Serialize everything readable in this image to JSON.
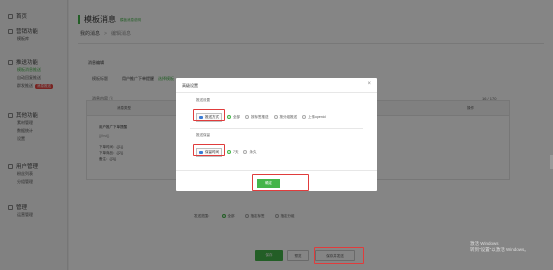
{
  "sidebar": {
    "groups": [
      {
        "label": "首页",
        "items": []
      },
      {
        "label": "营销功能",
        "items": [
          "模板库"
        ]
      },
      {
        "label": "推送功能",
        "items": [
          "模板消息推送",
          "自动回复推送",
          "群发推送"
        ],
        "badge": "消息推送"
      },
      {
        "label": "其他功能",
        "items": [
          "素材管理",
          "数据统计",
          "设置"
        ]
      },
      {
        "label": "用户管理",
        "items": [
          "粉丝列表",
          "分组管理"
        ]
      },
      {
        "label": "管理",
        "items": [
          "运营管理"
        ]
      }
    ]
  },
  "header": {
    "title": "模板消息",
    "subtitle": "模板消息说明"
  },
  "breadcrumb": {
    "first": "我的消息",
    "second": "编辑消息"
  },
  "content": {
    "section_label": "消息编辑",
    "field_label": "模板标题",
    "field_value": "用户推广下单提醒",
    "field_link": "选择模板",
    "preview_label": "消息内容 ①",
    "counter": "16 / 170",
    "col1": "消息类型",
    "col2": "详细内容",
    "col3": "操作",
    "msg_title": "用户推广下单提醒",
    "msg_lines": [
      "{{first}}",
      "下单时间：{{1}}",
      "下单商品：{{2}}",
      "备注：{{3}}"
    ],
    "send_label": "发送范围：",
    "send_options": [
      "全部",
      "指定标签",
      "指定分组"
    ]
  },
  "buttons": {
    "save": "保存",
    "preview": "预览",
    "send": "保存并发送"
  },
  "watermark": {
    "line1": "激活 Windows",
    "line2": "转到\"设置\"以激活 Windows。"
  },
  "modal": {
    "title": "高级设置",
    "close": "×",
    "section1": "推送设置",
    "chip1": "推送方式",
    "options1": [
      "全部",
      "按标签推送",
      "按分组推送",
      "上传openid"
    ],
    "section2": "推送保留",
    "chip2": "保留时间",
    "options2": [
      "7天",
      "永久"
    ],
    "confirm": "确定"
  },
  "colors": {
    "accent": "#44b549",
    "highlight": "#e03c3c"
  }
}
